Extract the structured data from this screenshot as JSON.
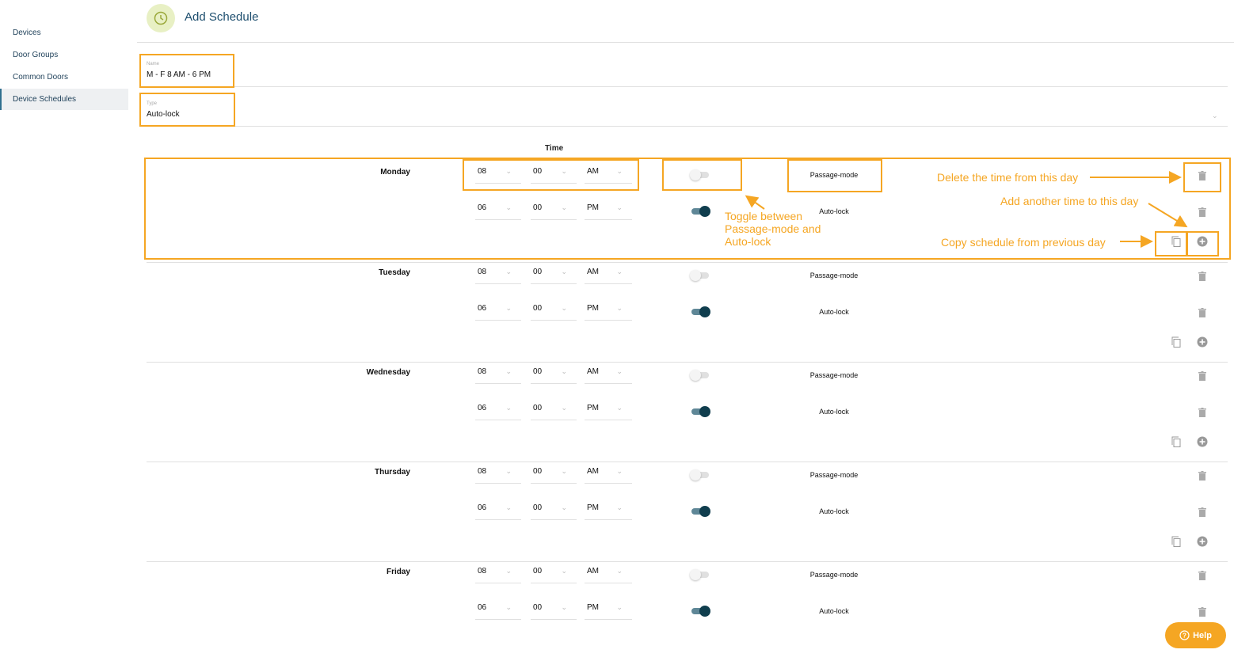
{
  "sidebar": {
    "items": [
      {
        "label": "Devices"
      },
      {
        "label": "Door Groups"
      },
      {
        "label": "Common Doors"
      },
      {
        "label": "Device Schedules",
        "active": true
      }
    ]
  },
  "header": {
    "title": "Add Schedule",
    "icon": "clock-icon"
  },
  "form": {
    "name_label": "Name",
    "name_value": "M - F 8 AM - 6 PM",
    "type_label": "Type",
    "type_value": "Auto-lock"
  },
  "time_header": "Time",
  "days": [
    {
      "name": "Monday",
      "slots": [
        {
          "hour": "08",
          "minute": "00",
          "ampm": "AM",
          "toggle_on": false,
          "mode": "Passage-mode"
        },
        {
          "hour": "06",
          "minute": "00",
          "ampm": "PM",
          "toggle_on": true,
          "mode": "Auto-lock"
        }
      ]
    },
    {
      "name": "Tuesday",
      "slots": [
        {
          "hour": "08",
          "minute": "00",
          "ampm": "AM",
          "toggle_on": false,
          "mode": "Passage-mode"
        },
        {
          "hour": "06",
          "minute": "00",
          "ampm": "PM",
          "toggle_on": true,
          "mode": "Auto-lock"
        }
      ]
    },
    {
      "name": "Wednesday",
      "slots": [
        {
          "hour": "08",
          "minute": "00",
          "ampm": "AM",
          "toggle_on": false,
          "mode": "Passage-mode"
        },
        {
          "hour": "06",
          "minute": "00",
          "ampm": "PM",
          "toggle_on": true,
          "mode": "Auto-lock"
        }
      ]
    },
    {
      "name": "Thursday",
      "slots": [
        {
          "hour": "08",
          "minute": "00",
          "ampm": "AM",
          "toggle_on": false,
          "mode": "Passage-mode"
        },
        {
          "hour": "06",
          "minute": "00",
          "ampm": "PM",
          "toggle_on": true,
          "mode": "Auto-lock"
        }
      ]
    },
    {
      "name": "Friday",
      "slots": [
        {
          "hour": "08",
          "minute": "00",
          "ampm": "AM",
          "toggle_on": false,
          "mode": "Passage-mode"
        },
        {
          "hour": "06",
          "minute": "00",
          "ampm": "PM",
          "toggle_on": true,
          "mode": "Auto-lock"
        }
      ]
    }
  ],
  "annotations": {
    "toggle_note": [
      "Toggle between",
      "Passage-mode and",
      "Auto-lock"
    ],
    "delete_note": "Delete the time from this day",
    "add_note": "Add another time to this day",
    "copy_note": "Copy schedule from previous day"
  },
  "help": {
    "label": "Help"
  },
  "colors": {
    "accent": "#f5a623",
    "toggle_on": "#103e4e",
    "title": "#1d4e6e"
  }
}
